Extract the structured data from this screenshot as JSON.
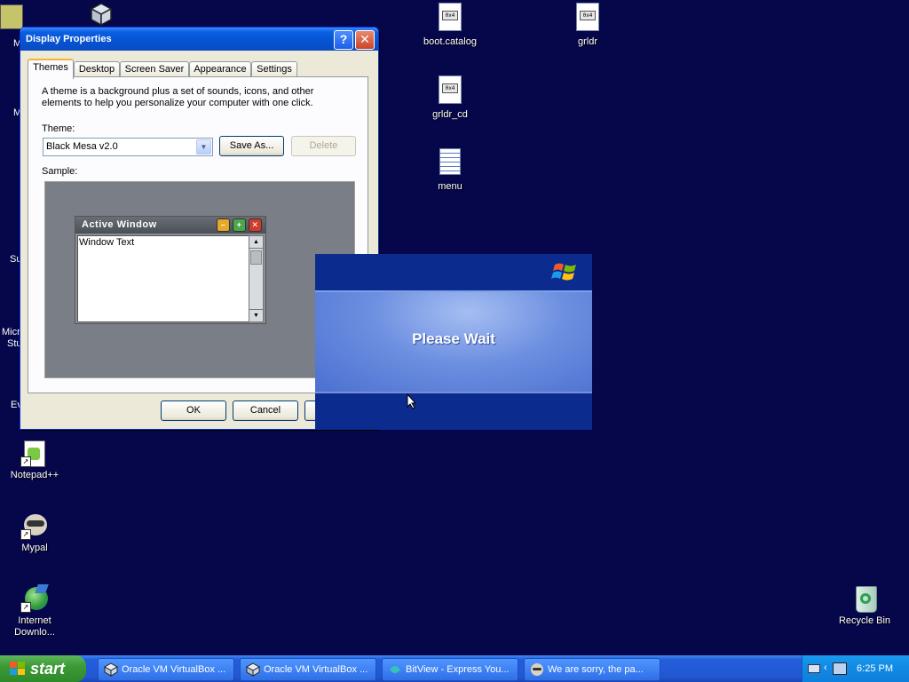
{
  "desktop": {
    "icons_right": [
      {
        "label": "boot.catalog",
        "badge": "0x4"
      },
      {
        "label": "grldr",
        "badge": "0x4"
      },
      {
        "label": "grldr_cd",
        "badge": "0x4"
      },
      {
        "label": "menu"
      }
    ],
    "icons_left": [
      {
        "label": "Notepad++"
      },
      {
        "label": "Mypal"
      },
      {
        "label": "Internet Downlo..."
      }
    ],
    "partial_left_labels": [
      "M",
      "M",
      "Su",
      "Micr",
      "Stu",
      "Ev"
    ],
    "recycle_bin": {
      "label": "Recycle Bin"
    }
  },
  "display_properties": {
    "title": "Display Properties",
    "tabs": [
      "Themes",
      "Desktop",
      "Screen Saver",
      "Appearance",
      "Settings"
    ],
    "description": "A theme is a background plus a set of sounds, icons, and other elements to help you personalize your computer with one click.",
    "theme_label": "Theme:",
    "theme_value": "Black Mesa v2.0",
    "save_as_label": "Save As...",
    "delete_label": "Delete",
    "sample_label": "Sample:",
    "sample": {
      "active_window_title": "Active Window",
      "window_text": "Window Text"
    },
    "ok_label": "OK",
    "cancel_label": "Cancel"
  },
  "please_wait": {
    "message": "Please Wait"
  },
  "taskbar": {
    "start_label": "start",
    "buttons": [
      {
        "label": "Oracle VM VirtualBox ..."
      },
      {
        "label": "Oracle VM VirtualBox ..."
      },
      {
        "label": "BitView - Express You..."
      },
      {
        "label": "We are sorry, the pa..."
      }
    ],
    "clock": "6:25 PM"
  }
}
